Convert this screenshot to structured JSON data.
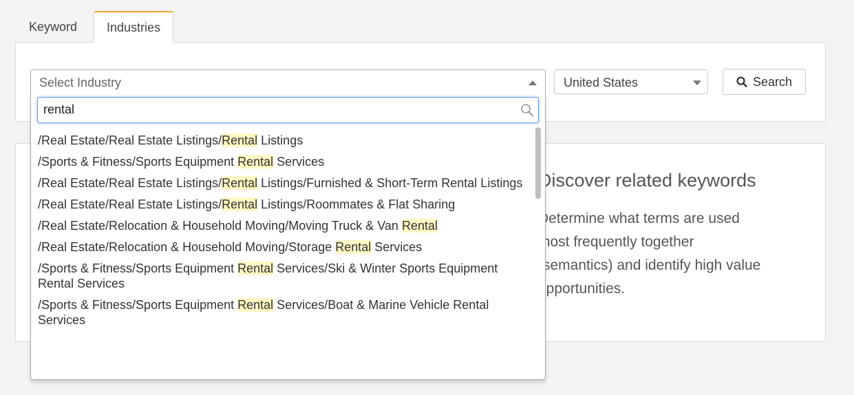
{
  "tabs": [
    {
      "label": "Keyword",
      "active": false
    },
    {
      "label": "Industries",
      "active": true
    }
  ],
  "filters": {
    "industry_placeholder": "Select Industry",
    "country_value": "United States",
    "search_label": "Search"
  },
  "dropdown": {
    "search_value": "rental",
    "options": [
      {
        "parts": [
          "/Real Estate/Real Estate Listings/",
          "Rental",
          " Listings"
        ]
      },
      {
        "parts": [
          "/Sports & Fitness/Sports Equipment ",
          "Rental",
          " Services"
        ]
      },
      {
        "parts": [
          "/Real Estate/Real Estate Listings/",
          "Rental",
          " Listings/Furnished & Short-Term Rental Listings"
        ]
      },
      {
        "parts": [
          "/Real Estate/Real Estate Listings/",
          "Rental",
          " Listings/Roommates & Flat Sharing"
        ]
      },
      {
        "parts": [
          "/Real Estate/Relocation & Household Moving/Moving Truck & Van ",
          "Rental",
          ""
        ]
      },
      {
        "parts": [
          "/Real Estate/Relocation & Household Moving/Storage ",
          "Rental",
          " Services"
        ]
      },
      {
        "parts": [
          "/Sports & Fitness/Sports Equipment ",
          "Rental",
          " Services/Ski & Winter Sports Equipment Rental Services"
        ]
      },
      {
        "parts": [
          "/Sports & Fitness/Sports Equipment ",
          "Rental",
          " Services/Boat & Marine Vehicle Rental Services"
        ]
      }
    ]
  },
  "promo": {
    "title": "Discover related keywords",
    "text": "Determine what terms are used most frequently together (semantics) and identify high value opportunities."
  },
  "colors": {
    "accent_tab": "#f5a623",
    "focus_border": "#5897fb",
    "highlight": "#fff8c4"
  },
  "icons": [
    "search-icon",
    "magnifier-icon",
    "caret-up-icon",
    "caret-down-icon"
  ]
}
